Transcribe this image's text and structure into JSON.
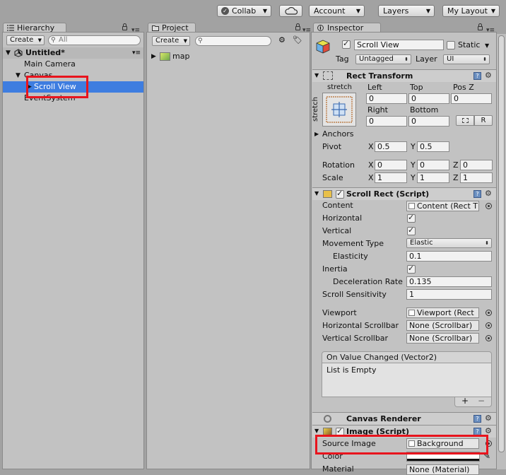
{
  "toolbar": {
    "collab": "Collab",
    "account": "Account",
    "layers": "Layers",
    "layout": "My Layout"
  },
  "hierarchy": {
    "tab": "Hierarchy",
    "create": "Create",
    "search_placeholder": "All",
    "scene": "Untitled*",
    "items": [
      "Main Camera",
      "Canvas",
      "Scroll View",
      "EventSystem"
    ]
  },
  "project": {
    "tab": "Project",
    "create": "Create",
    "items": [
      "map"
    ]
  },
  "inspector": {
    "tab": "Inspector",
    "object_name": "Scroll View",
    "static_label": "Static",
    "tag_label": "Tag",
    "tag_value": "Untagged",
    "layer_label": "Layer",
    "layer_value": "UI",
    "rect_transform": {
      "title": "Rect Transform",
      "stretch_top": "stretch",
      "stretch_side": "stretch",
      "left_label": "Left",
      "top_label": "Top",
      "posz_label": "Pos Z",
      "left": "0",
      "top": "0",
      "posz": "0",
      "right_label": "Right",
      "bottom_label": "Bottom",
      "right": "0",
      "bottom": "0",
      "raw_button": "R",
      "anchors_label": "Anchors",
      "pivot_label": "Pivot",
      "pivot_x": "0.5",
      "pivot_y": "0.5",
      "rotation_label": "Rotation",
      "rot_x": "0",
      "rot_y": "0",
      "rot_z": "0",
      "scale_label": "Scale",
      "scale_x": "1",
      "scale_y": "1",
      "scale_z": "1",
      "x": "X",
      "y": "Y",
      "z": "Z"
    },
    "scroll_rect": {
      "title": "Scroll Rect (Script)",
      "content_label": "Content",
      "content_value": "Content (Rect T",
      "horizontal_label": "Horizontal",
      "vertical_label": "Vertical",
      "movement_label": "Movement Type",
      "movement_value": "Elastic",
      "elasticity_label": "Elasticity",
      "elasticity_value": "0.1",
      "inertia_label": "Inertia",
      "deceleration_label": "Deceleration Rate",
      "deceleration_value": "0.135",
      "sensitivity_label": "Scroll Sensitivity",
      "sensitivity_value": "1",
      "viewport_label": "Viewport",
      "viewport_value": "Viewport (Rect",
      "hscroll_label": "Horizontal Scrollbar",
      "hscroll_value": "None (Scrollbar)",
      "vscroll_label": "Vertical Scrollbar",
      "vscroll_value": "None (Scrollbar)",
      "event_title": "On Value Changed (Vector2)",
      "event_empty": "List is Empty",
      "plus": "+",
      "minus": "−"
    },
    "canvas_renderer": {
      "title": "Canvas Renderer"
    },
    "image": {
      "title": "Image (Script)",
      "source_label": "Source Image",
      "source_value": "Background",
      "color_label": "Color",
      "material_label": "Material",
      "material_value": "None (Material)"
    }
  }
}
